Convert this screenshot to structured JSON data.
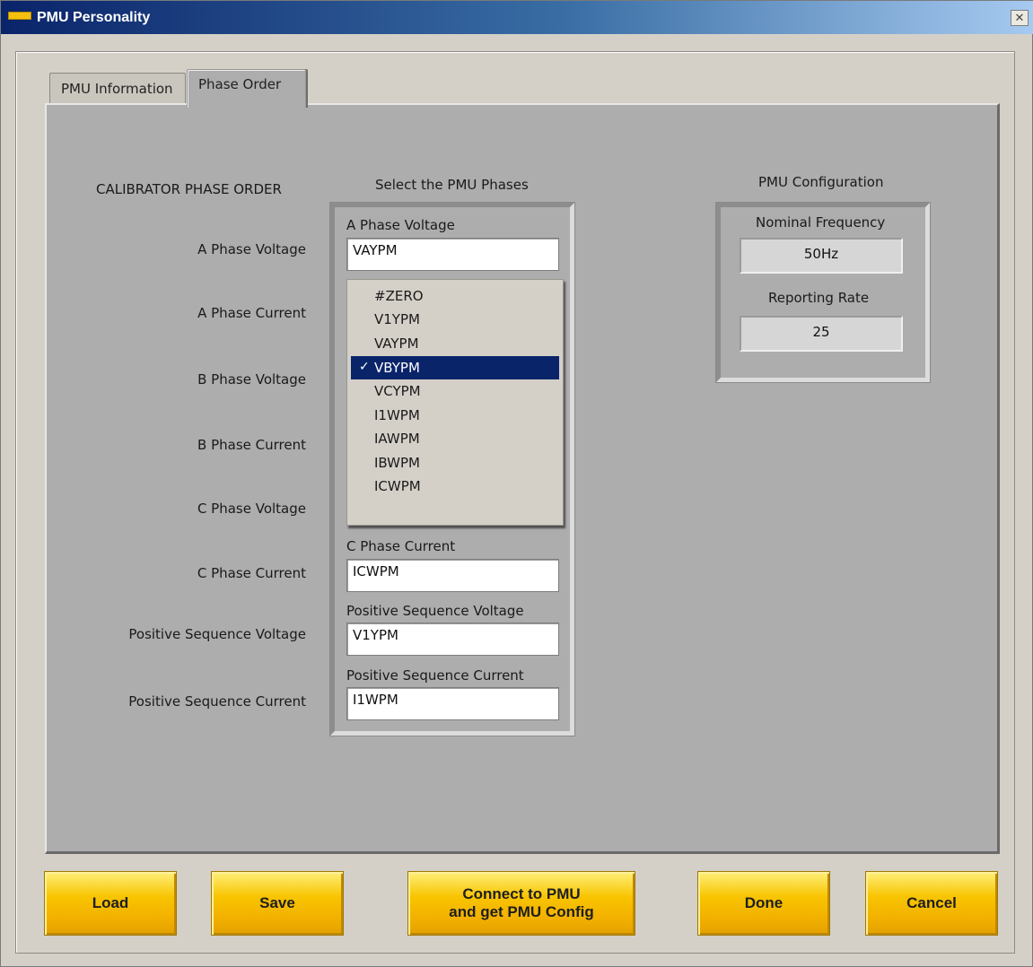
{
  "window": {
    "title": "PMU Personality",
    "close_glyph": "✕"
  },
  "tabs": [
    {
      "label": "PMU Information"
    },
    {
      "label": "Phase Order"
    }
  ],
  "calibrator": {
    "heading": "CALIBRATOR PHASE ORDER",
    "rows": [
      "A Phase Voltage",
      "A Phase Current",
      "B Phase Voltage",
      "B Phase Current",
      "C Phase Voltage",
      "C Phase Current",
      "Positive Sequence Voltage",
      "Positive Sequence Current"
    ]
  },
  "pmu_phases": {
    "heading": "Select the PMU Phases",
    "fields": {
      "a_voltage": {
        "label": "A Phase Voltage",
        "value": "VAYPM"
      },
      "c_current": {
        "label": "C Phase Current",
        "value": "ICWPM"
      },
      "pos_seq_voltage": {
        "label": "Positive Sequence Voltage",
        "value": "V1YPM"
      },
      "pos_seq_current": {
        "label": "Positive Sequence Current",
        "value": "I1WPM"
      }
    },
    "dropdown": {
      "options": [
        "#ZERO",
        "V1YPM",
        "VAYPM",
        "VBYPM",
        "VCYPM",
        "I1WPM",
        "IAWPM",
        "IBWPM",
        "ICWPM"
      ],
      "selected": "VBYPM",
      "check_glyph": "✓"
    }
  },
  "pmu_config": {
    "heading": "PMU Configuration",
    "nominal_frequency": {
      "label": "Nominal Frequency",
      "value": "50Hz"
    },
    "reporting_rate": {
      "label": "Reporting Rate",
      "value": "25"
    }
  },
  "buttons": {
    "load": "Load",
    "save": "Save",
    "connect_line1": "Connect to PMU",
    "connect_line2": "and get PMU Config",
    "done": "Done",
    "cancel": "Cancel"
  },
  "colors": {
    "titlebar": "#0a246a",
    "panel": "#adadad",
    "button": "#f8c400",
    "selection": "#0a246a"
  }
}
